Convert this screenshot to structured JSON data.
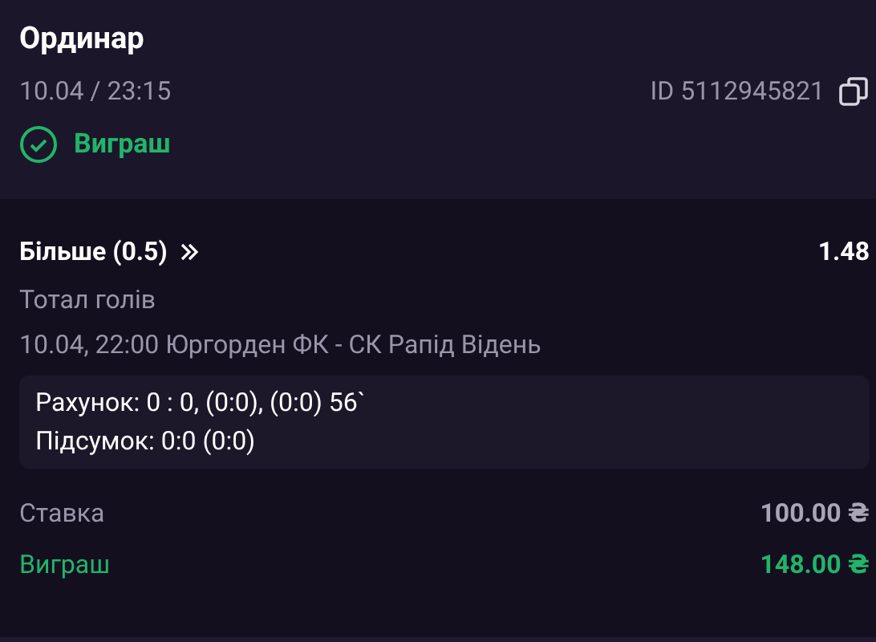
{
  "header": {
    "title": "Ординар",
    "datetime": "10.04 / 23:15",
    "bet_id": "ID 5112945821",
    "status": {
      "kind": "won",
      "label": "Виграш"
    }
  },
  "selection": {
    "name": "Більше (0.5)",
    "odds": "1.48",
    "market": "Тотал голів",
    "event": "10.04, 22:00 Юргорден ФК - СК Рапід Відень"
  },
  "details": [
    "Рахунок: 0 : 0, (0:0), (0:0) 56`",
    "Підсумок: 0:0 (0:0)"
  ],
  "summary": [
    {
      "kind": "stake",
      "label": "Ставка",
      "value": "100.00 ₴"
    },
    {
      "kind": "win",
      "label": "Виграш",
      "value": "148.00 ₴"
    }
  ]
}
